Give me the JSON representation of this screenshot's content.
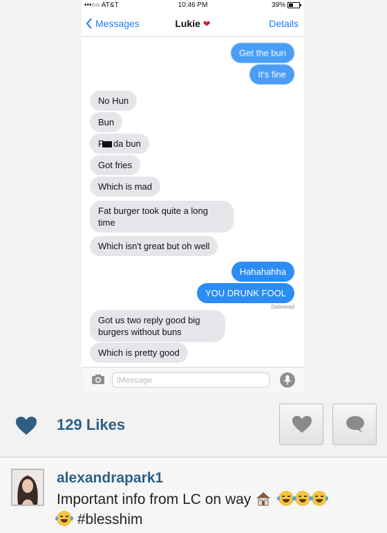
{
  "status_bar": {
    "carrier": "•••○○ AT&T",
    "time": "10:46 PM",
    "battery": "39%"
  },
  "nav": {
    "back_label": "Messages",
    "contact_name": "Lukie",
    "details_label": "Details"
  },
  "messages": [
    {
      "dir": "sent",
      "text": "Get the bun"
    },
    {
      "dir": "sent",
      "text": "It's fine"
    },
    {
      "dir": "received",
      "text": "No Hun"
    },
    {
      "dir": "received",
      "text": "Bun"
    },
    {
      "dir": "received",
      "text_pre": "F",
      "text_post": "da bun",
      "censored": true
    },
    {
      "dir": "received",
      "text": "Got fries"
    },
    {
      "dir": "received",
      "text": "Which is mad"
    },
    {
      "dir": "received",
      "text": "Fat burger took quite a long time"
    },
    {
      "dir": "received",
      "text": "Which isn't great but oh well"
    },
    {
      "dir": "sent",
      "text": "Hahahahha"
    },
    {
      "dir": "sent",
      "text": "YOU DRUNK FOOL"
    },
    {
      "dir": "received",
      "text": "Got us two reply good big burgers without buns"
    },
    {
      "dir": "received",
      "text": "Which is pretty good"
    }
  ],
  "delivered_label": "Delivered",
  "input": {
    "placeholder": "iMessage"
  },
  "instagram": {
    "likes": "129 Likes",
    "username": "alexandrapark1",
    "caption_text": "Important info from LC on way",
    "hashtag": "#blesshim"
  },
  "colors": {
    "sent_bubble": "#2b8cf5",
    "received_bubble": "#e6e5ea",
    "ios_blue": "#1a7cf5",
    "ig_blue": "#2e5e86"
  },
  "icons": [
    "camera-icon",
    "microphone-icon",
    "heart-icon",
    "comment-icon",
    "house-icon",
    "tears-of-joy-icon"
  ]
}
